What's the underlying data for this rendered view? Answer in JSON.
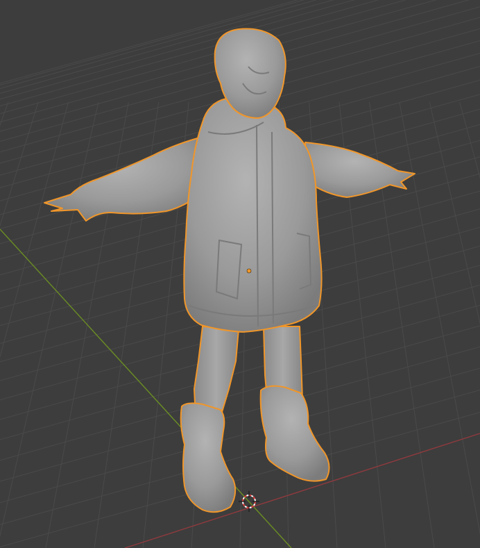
{
  "viewport": {
    "background": "#3d3d3d",
    "grid_color": "#4a4a4a",
    "x_axis_color": "#8f3a3e",
    "y_axis_color": "#6b8e23",
    "selection_outline_color": "#f0962a",
    "mesh_color": "#9a9a9a",
    "cursor_icon": "3d-cursor-icon",
    "origin_icon": "object-origin-icon",
    "object": "character-mesh"
  }
}
